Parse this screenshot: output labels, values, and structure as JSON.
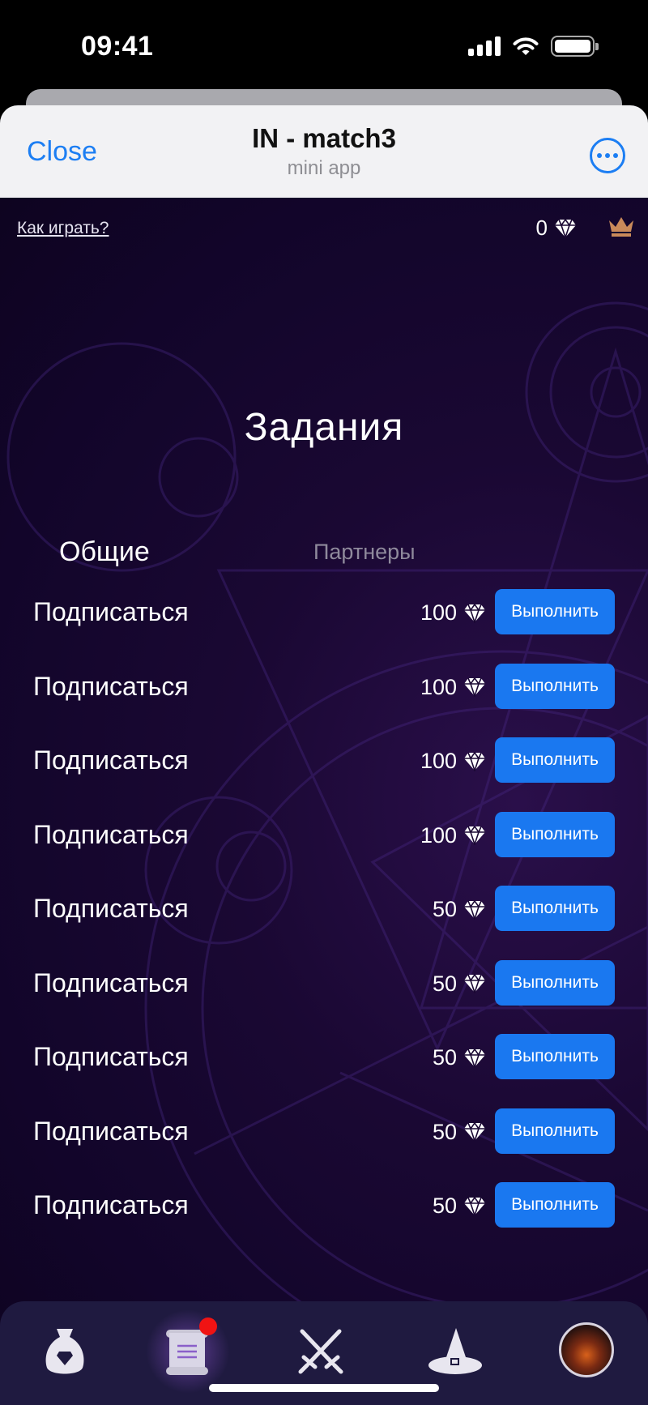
{
  "status_bar": {
    "time": "09:41"
  },
  "webview": {
    "close_label": "Close",
    "title": "IN - match3",
    "subtitle": "mini app"
  },
  "game": {
    "how_to_play": "Как играть?",
    "balance": "0",
    "title": "Задания",
    "tabs": [
      {
        "label": "Общие",
        "active": true
      },
      {
        "label": "Партнеры",
        "active": false
      }
    ],
    "tasks": [
      {
        "label": "Подписаться",
        "reward": "100",
        "button": "Выполнить"
      },
      {
        "label": "Подписаться",
        "reward": "100",
        "button": "Выполнить"
      },
      {
        "label": "Подписаться",
        "reward": "100",
        "button": "Выполнить"
      },
      {
        "label": "Подписаться",
        "reward": "100",
        "button": "Выполнить"
      },
      {
        "label": "Подписаться",
        "reward": "50",
        "button": "Выполнить"
      },
      {
        "label": "Подписаться",
        "reward": "50",
        "button": "Выполнить"
      },
      {
        "label": "Подписаться",
        "reward": "50",
        "button": "Выполнить"
      },
      {
        "label": "Подписаться",
        "reward": "50",
        "button": "Выполнить"
      },
      {
        "label": "Подписаться",
        "reward": "50",
        "button": "Выполнить"
      }
    ]
  },
  "bottom_nav": {
    "items": [
      {
        "icon": "gem-bag-icon",
        "active": false
      },
      {
        "icon": "scroll-icon",
        "active": true,
        "badge": true
      },
      {
        "icon": "crossed-swords-icon",
        "active": false
      },
      {
        "icon": "wizard-hat-icon",
        "active": false
      },
      {
        "icon": "avatar",
        "active": false
      }
    ]
  },
  "colors": {
    "accent": "#1a78f0",
    "link": "#1c7ef3",
    "background": "#12052a",
    "nav_background": "#1f1a40",
    "badge": "#f01313",
    "crown": "#c98a5a"
  }
}
